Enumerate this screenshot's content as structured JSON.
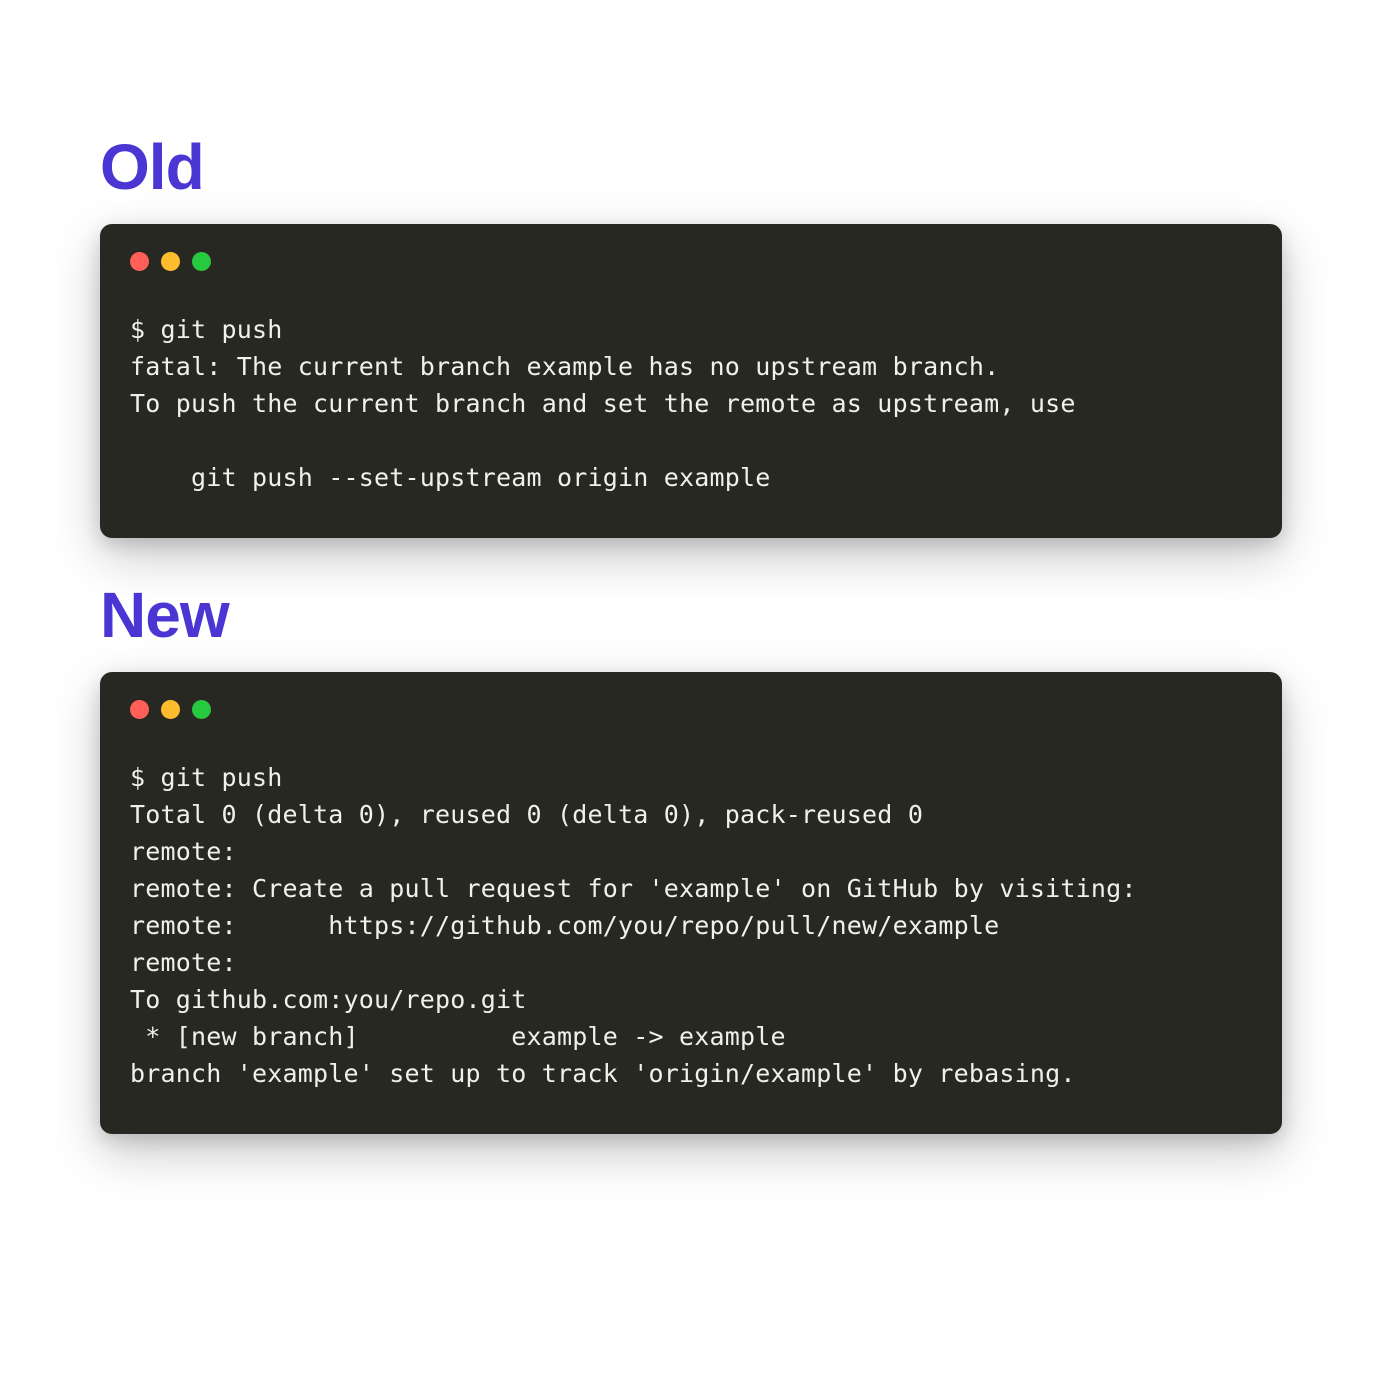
{
  "sections": {
    "old": {
      "heading": "Old",
      "terminal_text": "$ git push\nfatal: The current branch example has no upstream branch.\nTo push the current branch and set the remote as upstream, use\n\n    git push --set-upstream origin example"
    },
    "new": {
      "heading": "New",
      "terminal_text": "$ git push\nTotal 0 (delta 0), reused 0 (delta 0), pack-reused 0\nremote:\nremote: Create a pull request for 'example' on GitHub by visiting:\nremote:      https://github.com/you/repo/pull/new/example\nremote:\nTo github.com:you/repo.git\n * [new branch]          example -> example\nbranch 'example' set up to track 'origin/example' by rebasing."
    }
  },
  "colors": {
    "heading": "#4b35d3",
    "terminal_bg": "#272822",
    "terminal_fg": "#f0f0ec",
    "traffic_red": "#ff5f56",
    "traffic_yellow": "#ffbd2e",
    "traffic_green": "#27c93f"
  }
}
